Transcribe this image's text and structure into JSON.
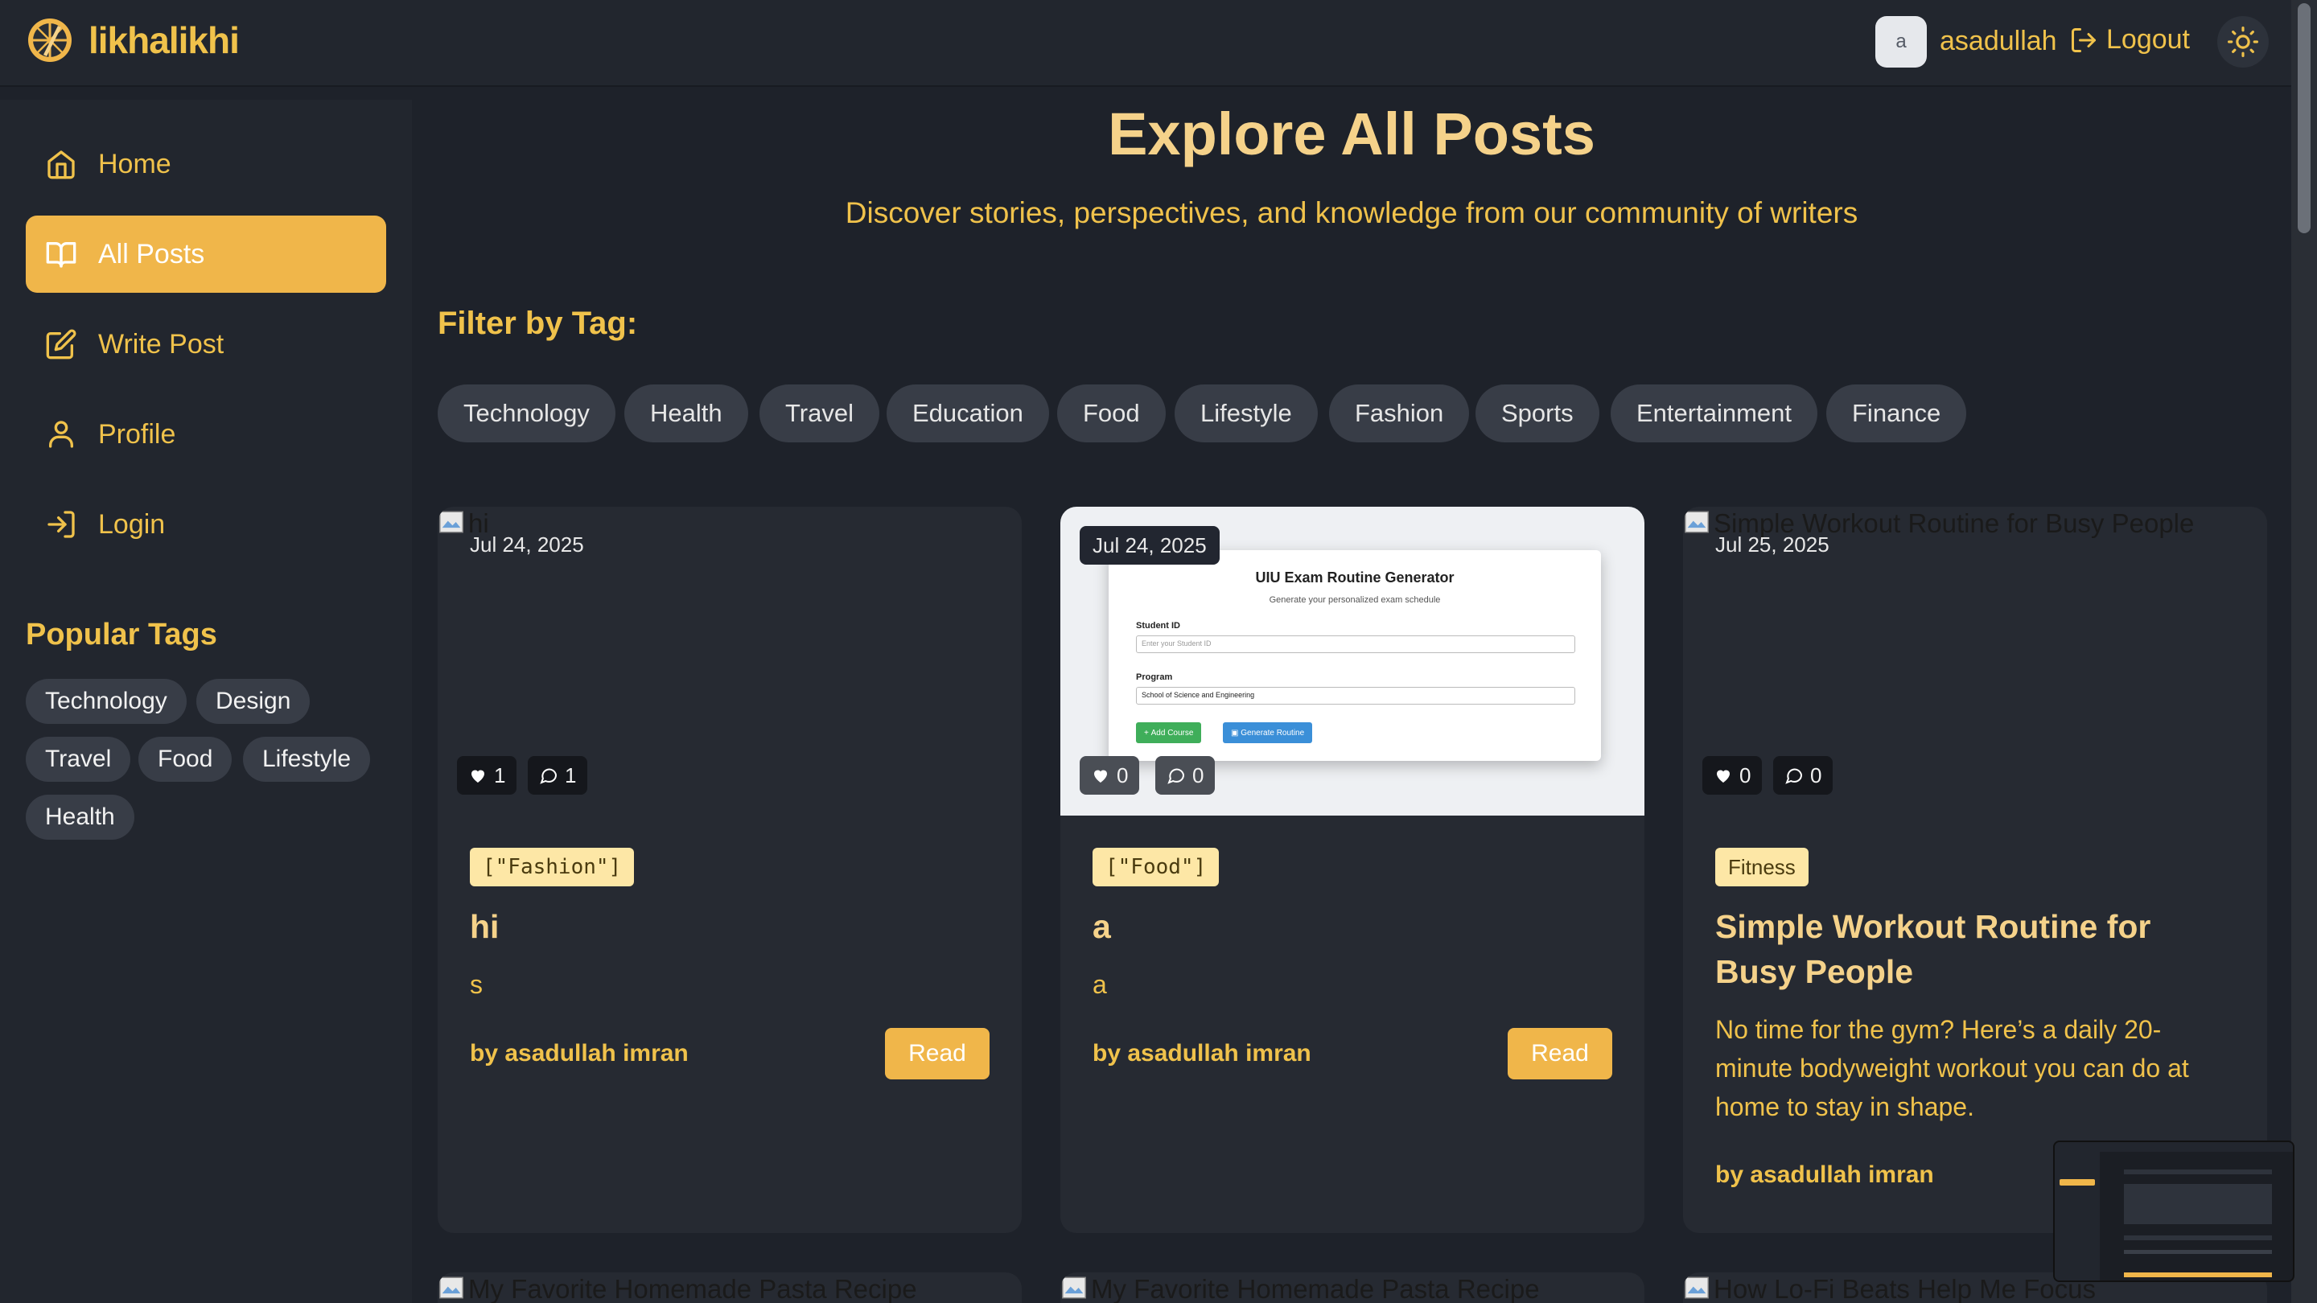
{
  "header": {
    "logo_text": "likhalikhi",
    "avatar_letter": "a",
    "username": "asadullah",
    "logout_label": "Logout"
  },
  "sidebar": {
    "nav": [
      {
        "label": "Home",
        "icon": "home-icon"
      },
      {
        "label": "All Posts",
        "icon": "book-icon",
        "active": true
      },
      {
        "label": "Write Post",
        "icon": "edit-icon"
      },
      {
        "label": "Profile",
        "icon": "user-icon"
      },
      {
        "label": "Login",
        "icon": "login-icon"
      }
    ],
    "popular_title": "Popular Tags",
    "popular_tags": [
      "Technology",
      "Design",
      "Travel",
      "Food",
      "Lifestyle",
      "Health"
    ]
  },
  "main": {
    "title": "Explore All Posts",
    "subtitle": "Discover stories, perspectives, and knowledge from our community of writers",
    "filter_title": "Filter by Tag:",
    "filter_tags": [
      "Technology",
      "Health",
      "Travel",
      "Education",
      "Food",
      "Lifestyle",
      "Fashion",
      "Sports",
      "Entertainment",
      "Finance"
    ]
  },
  "posts": [
    {
      "alt": "hi",
      "date": "Jul 24, 2025",
      "likes": "1",
      "comments": "1",
      "tag": "[\"Fashion\"]",
      "title": "hi",
      "excerpt": "s",
      "author": "by asadullah imran",
      "read_label": "Read"
    },
    {
      "date": "Jul 24, 2025",
      "likes": "0",
      "comments": "0",
      "tag": "[\"Food\"]",
      "title": "a",
      "excerpt": "a",
      "author": "by asadullah imran",
      "read_label": "Read",
      "image": {
        "heading": "UIU Exam Routine Generator",
        "sub": "Generate your personalized exam schedule",
        "student_label": "Student ID",
        "student_placeholder": "Enter your Student ID",
        "program_label": "Program",
        "program_value": "School of Science and Engineering",
        "add_btn": "Add Course",
        "gen_btn": "Generate Routine"
      }
    },
    {
      "alt": "Simple Workout Routine for Busy People",
      "date": "Jul 25, 2025",
      "likes": "0",
      "comments": "0",
      "tag": "Fitness",
      "title": "Simple Workout Routine for Busy People",
      "excerpt": "No time for the gym? Here’s a daily 20-minute bodyweight workout you can do at home to stay in shape.",
      "author": "by asadullah imran"
    }
  ],
  "next_row_alts": [
    "My Favorite Homemade Pasta Recipe",
    "My Favorite Homemade Pasta Recipe",
    "How Lo-Fi Beats Help Me Focus"
  ],
  "colors": {
    "accent": "#f0b64a",
    "text_accent": "#f0c24b",
    "background": "#1e222a",
    "panel": "#22262e",
    "card": "#262a32",
    "tag_bg": "#383d47",
    "card_tag_bg": "#fde7a6"
  }
}
